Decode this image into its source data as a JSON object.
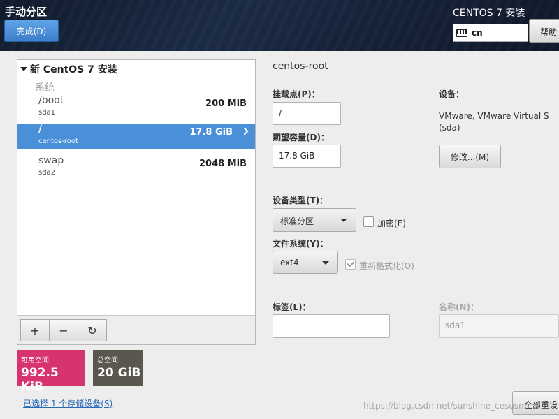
{
  "header": {
    "title": "手动分区",
    "done_label": "完成(D)",
    "product_title": "CENTOS 7 安装",
    "keyboard_layout": "cn",
    "help_label": "帮助"
  },
  "partition_list": {
    "install_title": "新 CentOS 7 安装",
    "section_label": "系统",
    "items": [
      {
        "mount": "/boot",
        "device": "sda1",
        "size": "200 MiB",
        "selected": false
      },
      {
        "mount": "/",
        "device": "centos-root",
        "size": "17.8 GiB",
        "selected": true
      },
      {
        "mount": "swap",
        "device": "sda2",
        "size": "2048 MiB",
        "selected": false
      }
    ],
    "add_symbol": "+",
    "remove_symbol": "−",
    "refresh_symbol": "↻"
  },
  "space": {
    "available_label": "可用空间",
    "available_value": "992.5 KiB",
    "available_color": "#d7336f",
    "total_label": "总空间",
    "total_value": "20 GiB",
    "total_color": "#5a574f"
  },
  "storage_link": "已选择 1 个存储设备(S)",
  "details": {
    "title": "centos-root",
    "mount_point_label": "挂载点(P)：",
    "mount_point_value": "/",
    "desired_capacity_label": "期望容量(D)：",
    "desired_capacity_value": "17.8 GiB",
    "device_label": "设备：",
    "device_value": "VMware, VMware Virtual S (sda)",
    "modify_label": "修改...(M)",
    "device_type_label": "设备类型(T)：",
    "device_type_value": "标准分区",
    "encrypt_label": "加密(E)",
    "filesystem_label": "文件系统(Y)：",
    "filesystem_value": "ext4",
    "reformat_label": "重新格式化(O)",
    "label_label": "标签(L)：",
    "label_value": "",
    "name_label": "名称(N)：",
    "name_value": "sda1"
  },
  "reset_all_label": "全部重设",
  "watermark": "https://blog.csdn.net/sunshine_cesusm"
}
